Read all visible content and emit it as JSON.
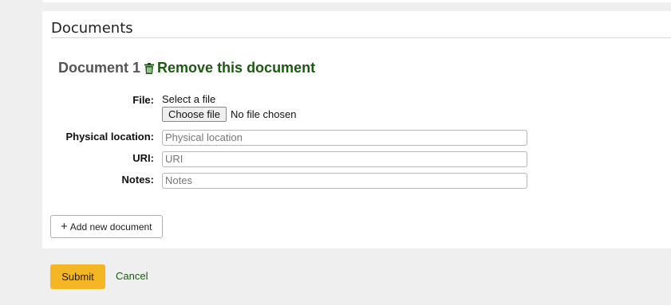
{
  "section": {
    "title": "Documents"
  },
  "document": {
    "title": "Document 1",
    "remove_label": "Remove this document"
  },
  "fields": {
    "file": {
      "label": "File:",
      "caption": "Select a file",
      "button_label": "Choose file",
      "status": "No file chosen"
    },
    "physical_location": {
      "label": "Physical location:",
      "placeholder": "Physical location"
    },
    "uri": {
      "label": "URI:",
      "placeholder": "URI"
    },
    "notes": {
      "label": "Notes:",
      "placeholder": "Notes"
    }
  },
  "actions": {
    "add_document_label": "Add new document",
    "submit_label": "Submit",
    "cancel_label": "Cancel"
  },
  "icons": {
    "remove": "trash-icon",
    "add": "plus-icon"
  },
  "colors": {
    "link_green": "#1c5a12",
    "submit_yellow": "#f4b625",
    "background": "#eeefee"
  }
}
